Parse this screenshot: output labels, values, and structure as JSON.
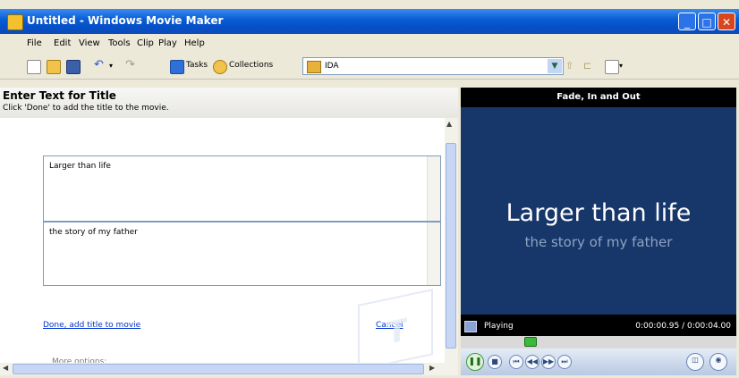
{
  "window": {
    "title": "Untitled - Windows Movie Maker"
  },
  "menu": [
    "File",
    "Edit",
    "View",
    "Tools",
    "Clip",
    "Play",
    "Help"
  ],
  "toolbar": {
    "tasks_label": "Tasks",
    "collections_label": "Collections",
    "collection_value": "IDA"
  },
  "task_panel": {
    "heading": "Enter Text for Title",
    "instruction": "Click 'Done' to add the title to the movie.",
    "title_text": "Larger than life",
    "subtitle_text": "the story of my father",
    "done_link": "Done, add title to movie",
    "cancel_link": "Cancel",
    "more_options": "More options:"
  },
  "monitor": {
    "effect_name": "Fade, In and Out",
    "preview_title": "Larger than life",
    "preview_subtitle": "the story of my father",
    "status": "Playing",
    "time": "0:00:00.95 / 0:00:04.00",
    "seek_fraction": 0.24
  },
  "colors": {
    "titlebar": "#0a5fd6",
    "preview_bg": "#17376a",
    "link": "#0033cc"
  }
}
